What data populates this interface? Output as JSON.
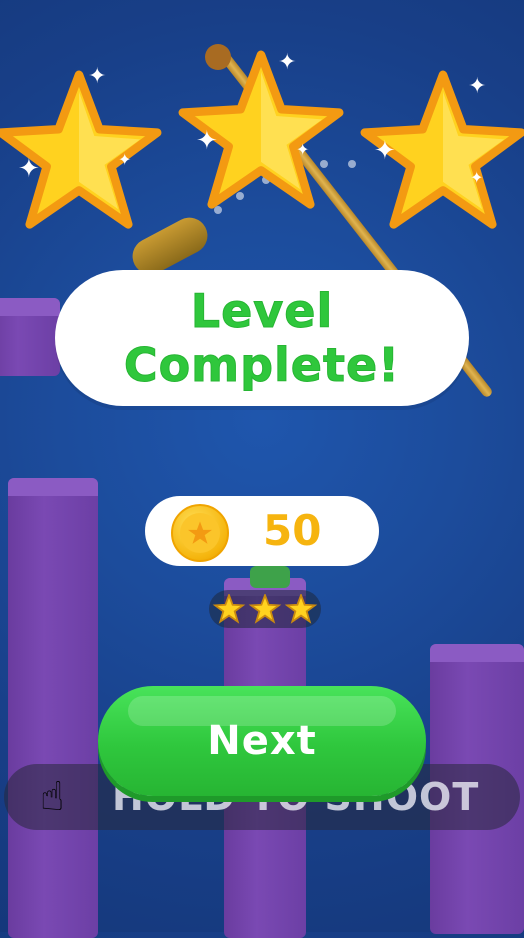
{
  "result": {
    "stars_earned": 3,
    "stars_total": 3,
    "title_line1": "Level",
    "title_line2": "Complete!",
    "coins": "50"
  },
  "hint": {
    "icon": "hand-pointer-icon",
    "text": "HOLD TO SHOOT"
  },
  "actions": {
    "next_label": "Next"
  },
  "colors": {
    "background": "#1c4c9c",
    "title_green": "#2fc73c",
    "coin_gold": "#f6b40f",
    "button_green": "#2fc73d",
    "star_yellow": "#ffd21f",
    "star_border": "#f39a12"
  }
}
